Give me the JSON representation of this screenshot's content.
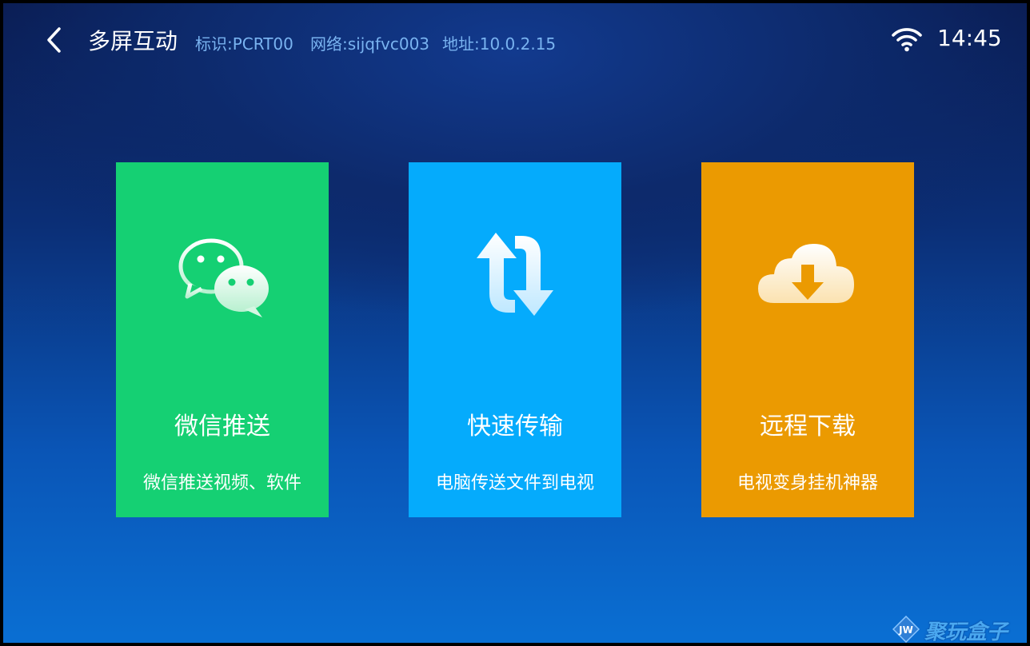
{
  "header": {
    "title": "多屏互动",
    "device_id": "标识:PCRT00",
    "network": "网络:sijqfvc003",
    "address": "地址:10.0.2.15",
    "time": "14:45"
  },
  "cards": [
    {
      "title": "微信推送",
      "subtitle": "微信推送视频、软件",
      "color": "#15d073",
      "icon": "wechat-icon"
    },
    {
      "title": "快速传输",
      "subtitle": "电脑传送文件到电视",
      "color": "#05abfc",
      "icon": "transfer-arrows-icon"
    },
    {
      "title": "远程下载",
      "subtitle": "电视变身挂机神器",
      "color": "#eb9a01",
      "icon": "cloud-download-icon"
    }
  ],
  "watermark": {
    "logo": "JW",
    "text": "聚玩盒子"
  }
}
